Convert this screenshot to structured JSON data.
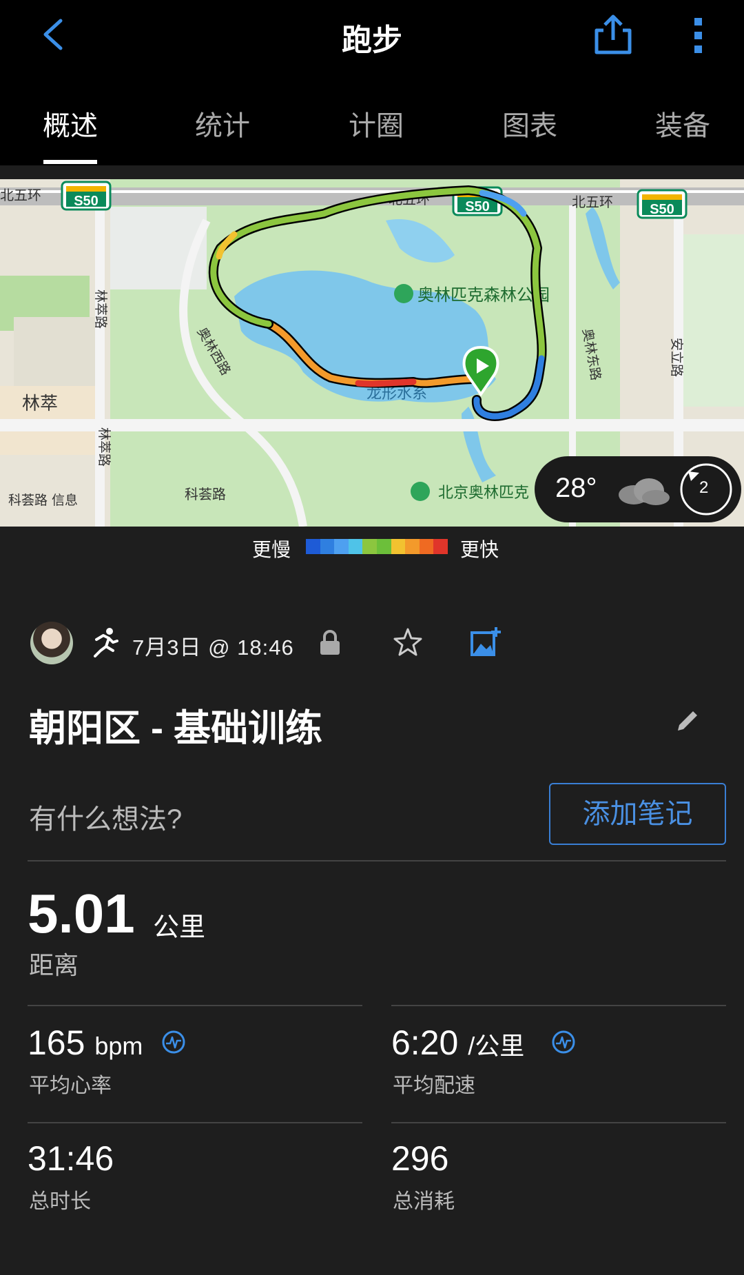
{
  "header": {
    "title": "跑步"
  },
  "tabs": [
    {
      "label": "概述",
      "active": true
    },
    {
      "label": "统计"
    },
    {
      "label": "计圈"
    },
    {
      "label": "图表"
    },
    {
      "label": "装备"
    }
  ],
  "map": {
    "labels": {
      "north_ring_1": "北五环",
      "north_ring_2": "北五环",
      "north_ring_3": "北五环",
      "highway_1": "S50",
      "highway_2": "S50",
      "highway_3": "S50",
      "park_name": "奥林匹克森林公园",
      "lake": "龙形水系",
      "west_road": "奥林西路",
      "east_road": "奥林东路",
      "linc_road_1": "林萃路",
      "linc_road_2": "林萃路",
      "anli_road": "安立路",
      "lincui": "林萃",
      "kehui_road": "科荟路",
      "park_gate": "北京奥林匹克",
      "map_info": "科荟路 信息"
    },
    "weather": {
      "temperature": "28°",
      "icon": "cloud-icon",
      "wind_level": "2"
    }
  },
  "legend": {
    "slower": "更慢",
    "faster": "更快",
    "colors": [
      "#1e5bd6",
      "#2f7fe0",
      "#4ea0f0",
      "#4fc3e8",
      "#8cc63f",
      "#6cbf3a",
      "#f2c230",
      "#f39a2b",
      "#ef6a22",
      "#e0352a"
    ]
  },
  "activity": {
    "date": "7月3日 @ 18:46",
    "title": "朝阳区 - 基础训练",
    "thoughts_placeholder": "有什么想法?",
    "add_note_label": "添加笔记"
  },
  "stats": {
    "distance": {
      "value": "5.01",
      "unit": "公里",
      "label": "距离"
    },
    "heart_rate": {
      "value": "165",
      "unit": "bpm",
      "label": "平均心率"
    },
    "pace": {
      "value": "6:20",
      "unit": "/公里",
      "label": "平均配速"
    },
    "duration": {
      "value": "31:46",
      "label": "总时长"
    },
    "calories": {
      "value": "296",
      "label": "总消耗"
    }
  },
  "colors": {
    "accent": "#4a90e2",
    "background": "#1e1e1e",
    "topbar": "#000000"
  }
}
